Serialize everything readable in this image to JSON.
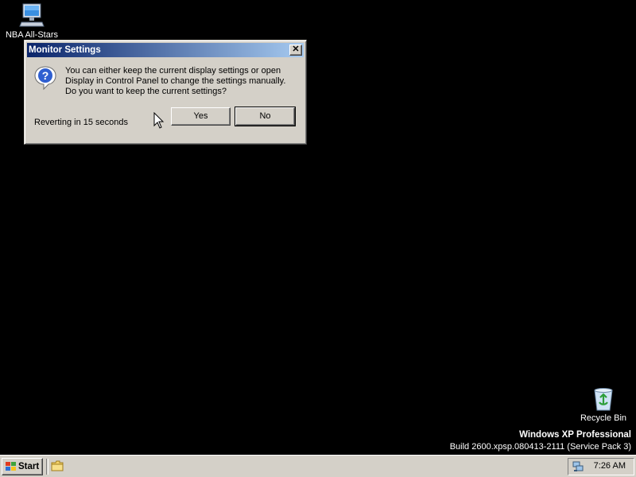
{
  "desktop": {
    "icons": [
      {
        "label": "NBA All-Stars",
        "icon": "computer-icon"
      },
      {
        "label": "Recycle Bin",
        "icon": "recycle-bin-icon"
      }
    ],
    "watermark": {
      "title": "Windows XP Professional",
      "build": "Build 2600.xpsp.080413-2111 (Service Pack 3)"
    }
  },
  "dialog": {
    "title": "Monitor Settings",
    "close_label": "✕",
    "icon": "question-icon",
    "message_lines": [
      "You can either keep the current display settings or open",
      "Display in Control Panel to change the settings manually.",
      "Do you want to keep the current settings?"
    ],
    "countdown": "Reverting in 15 seconds",
    "yes_label": "Yes",
    "no_label": "No"
  },
  "taskbar": {
    "start_label": "Start",
    "quick_launch": [
      {
        "icon": "folder-icon"
      }
    ],
    "tray_icon": "network-icon",
    "clock": "7:26 AM"
  },
  "colors": {
    "desktop_bg": "#000000",
    "title_gradient_start": "#0a246a",
    "title_gradient_end": "#a6caf0",
    "face": "#d4d0c8"
  }
}
